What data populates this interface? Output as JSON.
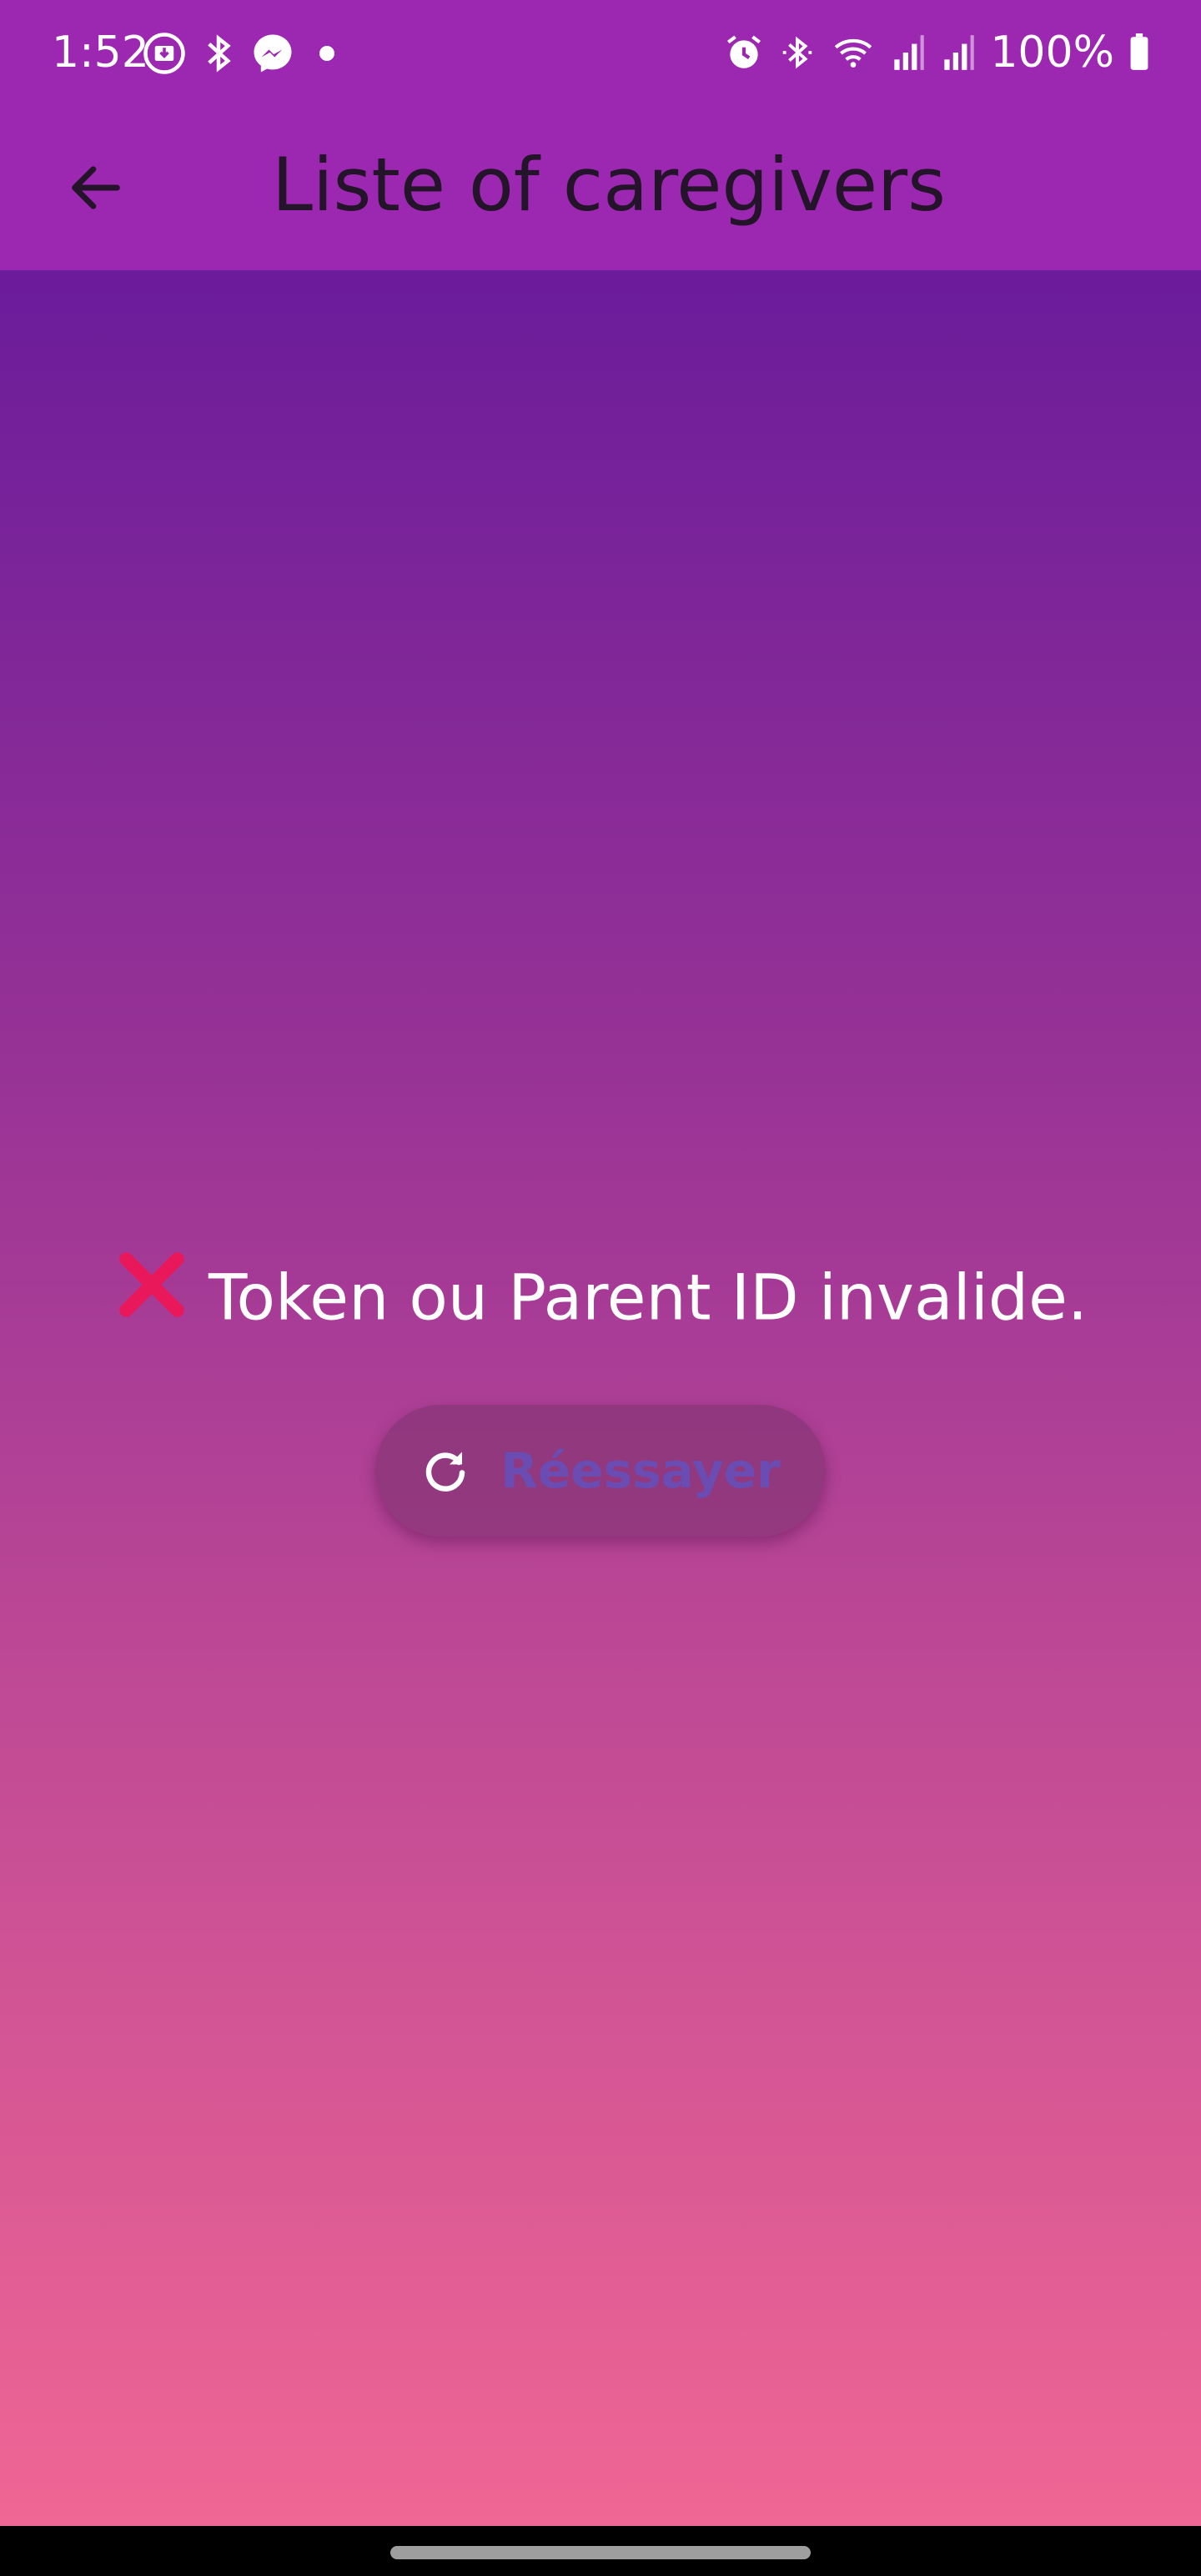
{
  "status_bar": {
    "time": "1:52",
    "battery": "100%",
    "left_icons": [
      "download-icon",
      "bluetooth-icon",
      "messenger-icon",
      "dot-icon"
    ],
    "right_icons": [
      "alarm-icon",
      "bluetooth-icon",
      "wifi-icon",
      "signal-icon",
      "signal-icon",
      "battery-icon"
    ]
  },
  "app_bar": {
    "title": "Liste of caregivers",
    "back_icon": "arrow-back-icon"
  },
  "content": {
    "error_icon": "cross-mark-icon",
    "error_text": "Token ou Parent ID invalide.",
    "retry_icon": "refresh-icon",
    "retry_label": "Réessayer"
  },
  "colors": {
    "app_bar": "#9c27b0",
    "gradient_top": "#6b1c9b",
    "gradient_bottom": "#f06694",
    "title_text": "#24142a",
    "retry_label": "#6a4cb3"
  }
}
